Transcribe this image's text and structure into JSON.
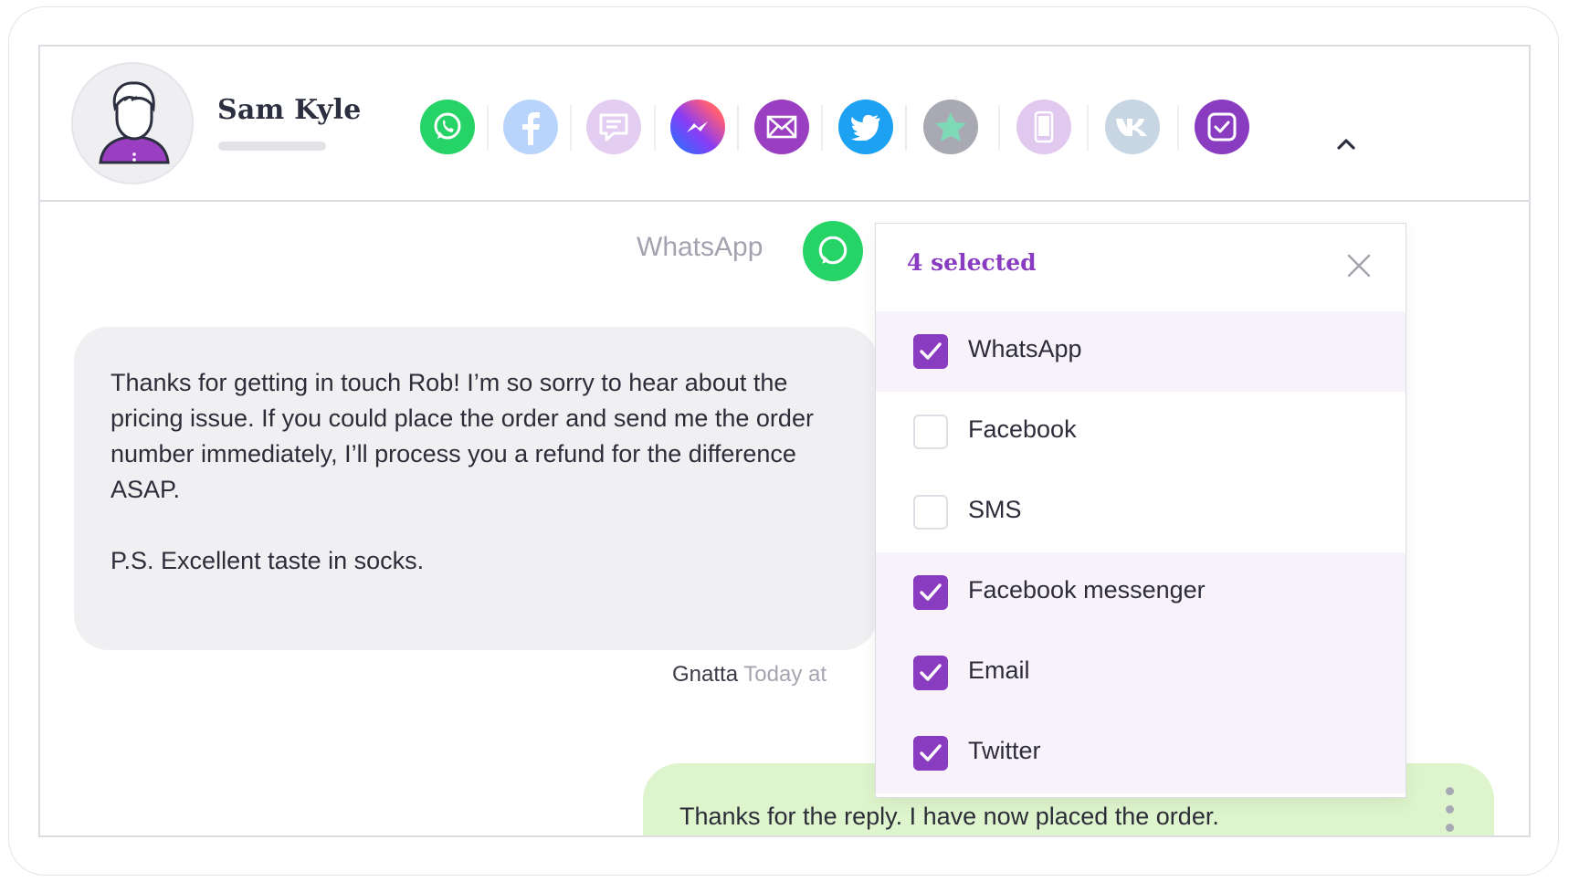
{
  "contact": {
    "name": "Sam Kyle"
  },
  "channels_bar": [
    {
      "name": "WhatsApp",
      "icon": "whatsapp-icon",
      "color": "#25d366",
      "active": true
    },
    {
      "name": "Facebook",
      "icon": "facebook-icon",
      "color": "#b8d4fb",
      "active": false
    },
    {
      "name": "SMS",
      "icon": "sms-icon",
      "color": "#e3cdf0",
      "active": false
    },
    {
      "name": "Facebook messenger",
      "icon": "messenger-icon",
      "color": "#a334fa",
      "active": true
    },
    {
      "name": "Email",
      "icon": "email-icon",
      "color": "#9b3fc2",
      "active": true
    },
    {
      "name": "Twitter",
      "icon": "twitter-icon",
      "color": "#1da1f2",
      "active": true
    },
    {
      "name": "Favourite",
      "icon": "star-icon",
      "color": "#a9a9b4",
      "active": false
    },
    {
      "name": "Phone",
      "icon": "phone-icon",
      "color": "#e1c8ef",
      "active": false
    },
    {
      "name": "VK",
      "icon": "vk-icon",
      "color": "#c8d6e4",
      "active": false
    },
    {
      "name": "Select channels",
      "icon": "checkbox-filter-icon",
      "color": "#8a3cc0",
      "active": true
    }
  ],
  "conversation": {
    "channel_label": "WhatsApp",
    "incoming_message": {
      "paragraphs": [
        "Thanks for getting in touch Rob! I’m so sorry to hear about the pricing issue. If you could place the order and send me the order number immediately, I’ll process you a refund for the difference ASAP.",
        "P.S. Excellent taste in socks."
      ],
      "sender": "Gnatta",
      "time_text": "Today at"
    },
    "outgoing_message": {
      "text": "Thanks for the reply. I have now placed the order."
    }
  },
  "channel_filter": {
    "count_text": "4 selected",
    "items": [
      {
        "label": "WhatsApp",
        "checked": true
      },
      {
        "label": "Facebook",
        "checked": false
      },
      {
        "label": "SMS",
        "checked": false
      },
      {
        "label": "Facebook messenger",
        "checked": true
      },
      {
        "label": "Email",
        "checked": true
      },
      {
        "label": "Twitter",
        "checked": true
      }
    ]
  },
  "colors": {
    "accent": "#8a3cc0",
    "incoming_bubble": "#f0f0f2",
    "outgoing_bubble": "#def4cc"
  }
}
